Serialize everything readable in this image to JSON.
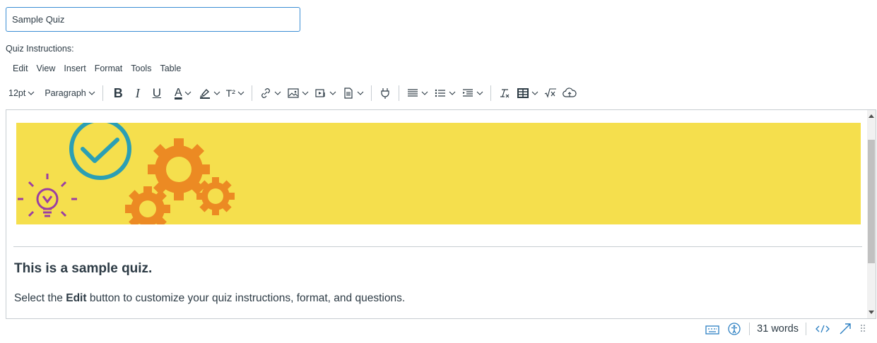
{
  "title_input": {
    "value": "Sample Quiz"
  },
  "instructions_label": "Quiz Instructions:",
  "menubar": {
    "items": [
      "Edit",
      "View",
      "Insert",
      "Format",
      "Tools",
      "Table"
    ]
  },
  "toolbar": {
    "font_size": "12pt",
    "block_format": "Paragraph",
    "bold": "B",
    "italic": "I",
    "underline": "U",
    "text_color": "A",
    "superscript": "T²"
  },
  "content": {
    "heading": "This is a sample quiz.",
    "para_before": "Select the ",
    "para_bold": "Edit",
    "para_after": " button to customize your quiz instructions, format, and questions."
  },
  "status_bar": {
    "word_count": "31 words"
  },
  "colors": {
    "banner": "#f5df4d",
    "accent": "#2b9fb4",
    "gear": "#ec8a23",
    "bulb": "#9b3fa3"
  }
}
